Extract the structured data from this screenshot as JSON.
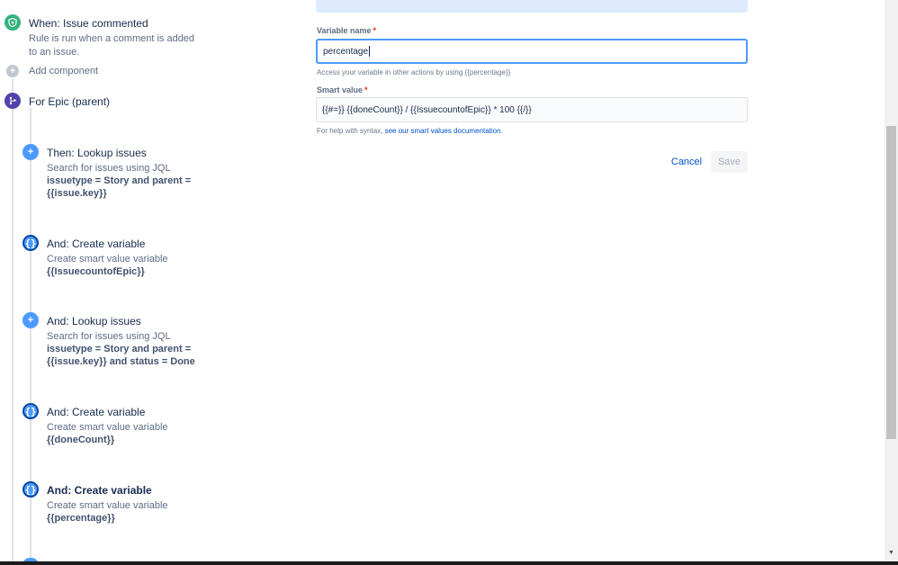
{
  "trigger": {
    "title": "When: Issue commented",
    "description": "Rule is run when a comment is added to an issue."
  },
  "add_component": {
    "label": "Add component"
  },
  "branch": {
    "title": "For Epic (parent)"
  },
  "actions": [
    {
      "title": "Then: Lookup issues",
      "description": "Search for issues using JQL",
      "detail_1": "issuetype = Story and parent =",
      "detail_2": "{{issue.key}}"
    },
    {
      "title": "And: Create variable",
      "description": "Create smart value variable",
      "detail_1": "{{IssuecountofEpic}}"
    },
    {
      "title": "And: Lookup issues",
      "description": "Search for issues using JQL",
      "detail_1": "issuetype = Story and parent =",
      "detail_2": "{{issue.key}} and status = Done"
    },
    {
      "title": "And: Create variable",
      "description": "Create smart value variable",
      "detail_1": "{{doneCount}}"
    },
    {
      "title": "And: Create variable",
      "description": "Create smart value variable",
      "detail_1": "{{percentage}}"
    }
  ],
  "form": {
    "variable_name_label": "Variable name",
    "required_mark": "*",
    "variable_name_value": "percentage",
    "variable_help": "Access your variable in other actions by using {{percentage}}",
    "smart_value_label": "Smart value",
    "smart_value_value": "{{#=}} {{doneCount}} / {{IssuecountofEpic}} * 100 {{/}}",
    "syntax_help_prefix": "For help with syntax, ",
    "syntax_help_link": "see our smart values documentation",
    "syntax_help_suffix": ".",
    "cancel_label": "Cancel",
    "save_label": "Save"
  },
  "icons": {
    "trigger": "shield-icon",
    "add": "plus-icon",
    "branch": "branch-icon",
    "lookup": "plus-icon",
    "variable": "braces-icon"
  },
  "colors": {
    "trigger": "#36b37e",
    "branch": "#5243aa",
    "action": "#4c9aff",
    "link": "#0052cc",
    "focus": "#4c9aff"
  }
}
